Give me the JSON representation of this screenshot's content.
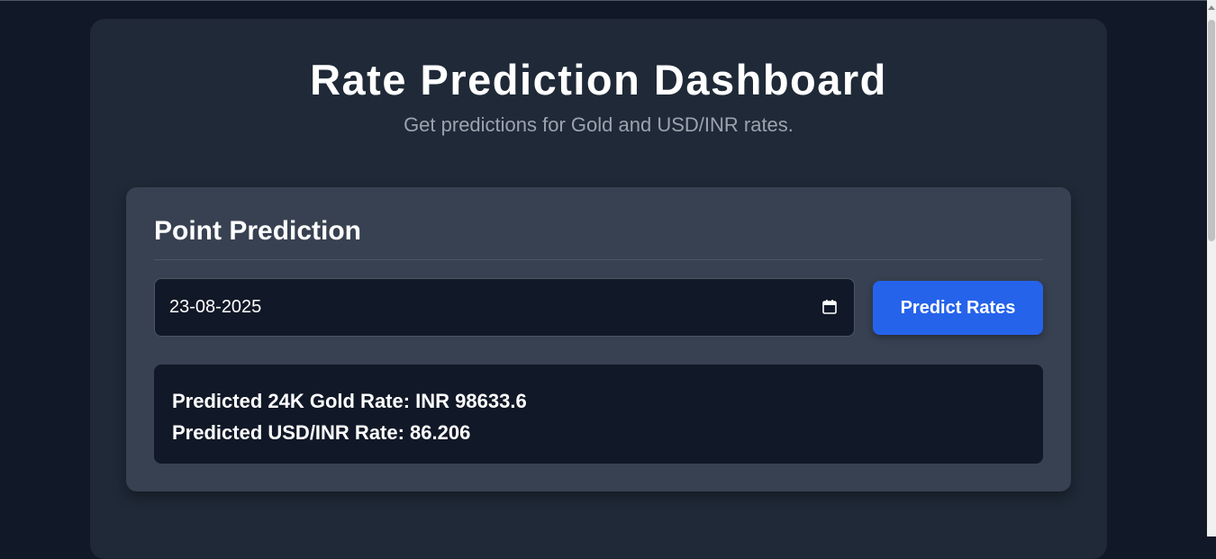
{
  "header": {
    "title": "Rate Prediction Dashboard",
    "subtitle": "Get predictions for Gold and USD/INR rates."
  },
  "point_prediction": {
    "title": "Point Prediction",
    "date_value": "23-08-2025",
    "button_label": "Predict Rates",
    "results": {
      "gold": "Predicted 24K Gold Rate: INR 98633.6",
      "usdinr": "Predicted USD/INR Rate: 86.206"
    }
  },
  "colors": {
    "background": "#111827",
    "container": "#1f2937",
    "card": "#374151",
    "accent": "#2563eb",
    "muted_text": "#9ca3af"
  },
  "icons": {
    "date_picker": "calendar-icon"
  }
}
